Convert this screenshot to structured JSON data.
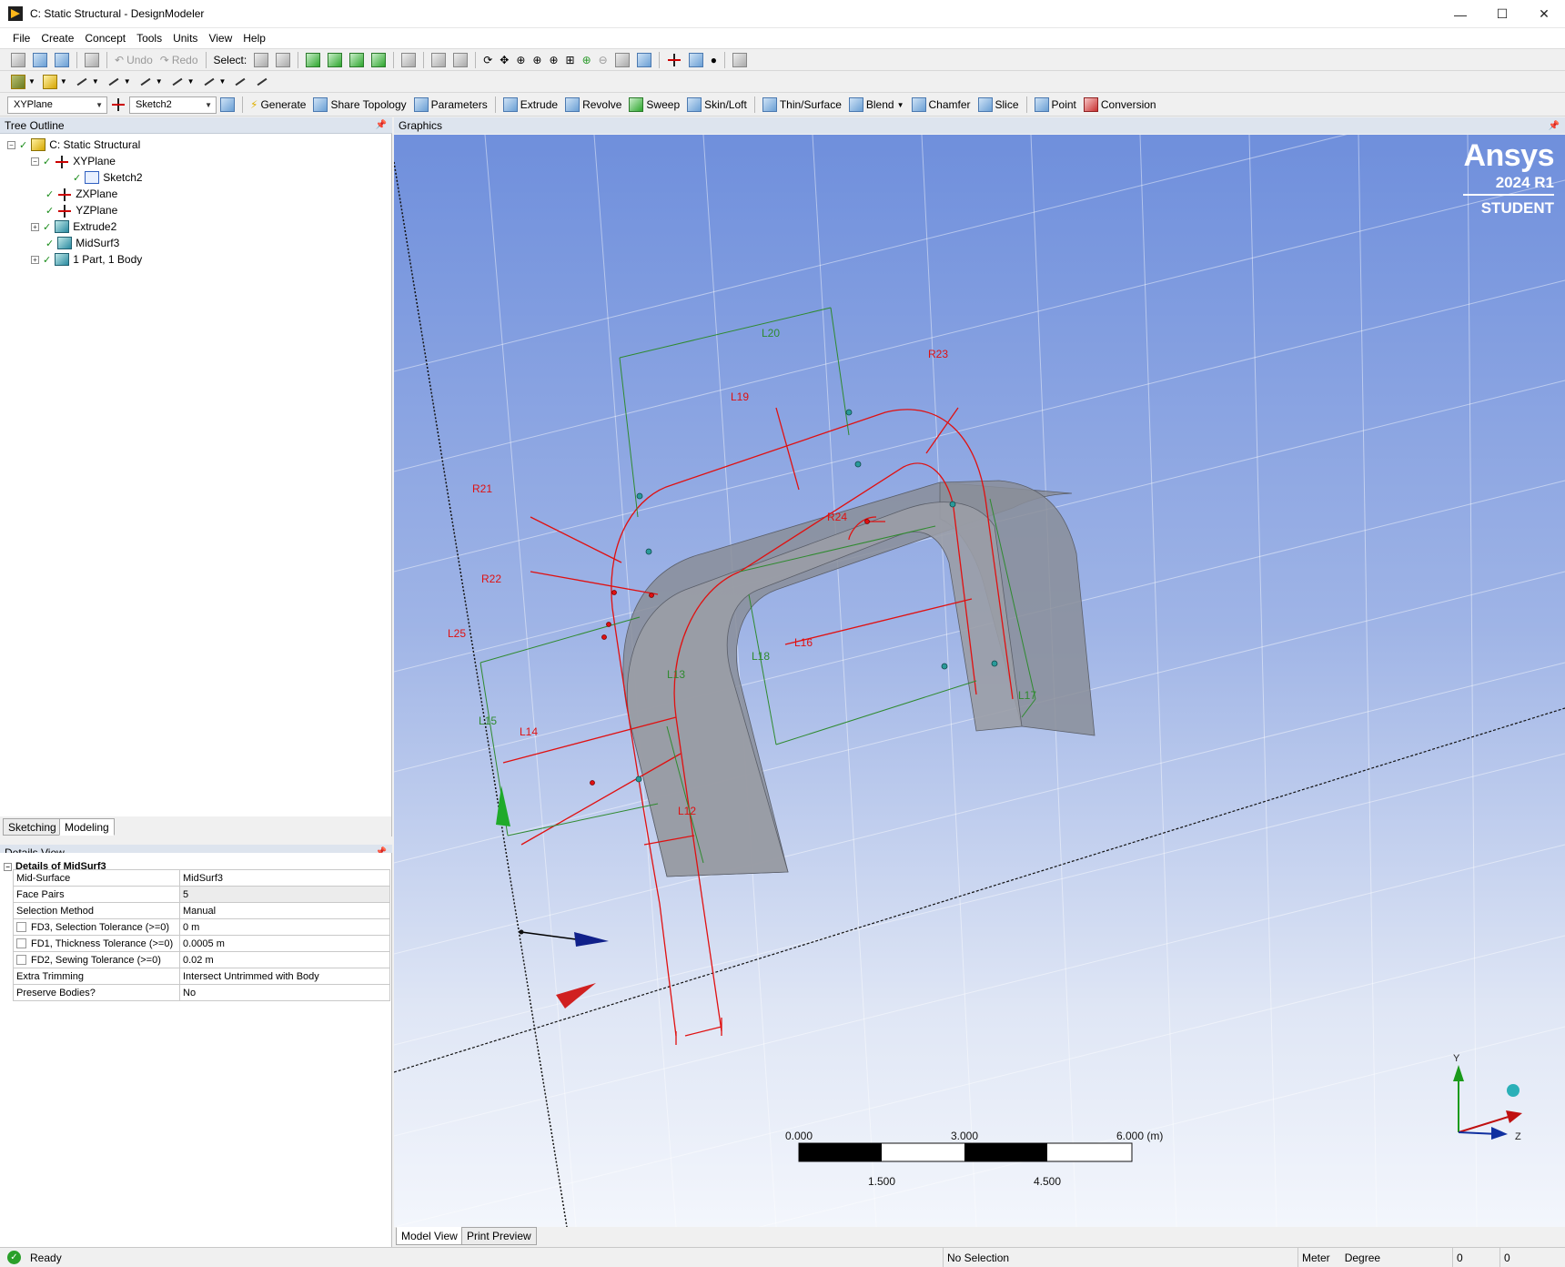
{
  "window": {
    "title": "C: Static Structural - DesignModeler",
    "controls": {
      "minimize": "—",
      "maximize": "☐",
      "close": "✕"
    }
  },
  "menu": [
    "File",
    "Create",
    "Concept",
    "Tools",
    "Units",
    "View",
    "Help"
  ],
  "toolbar1": {
    "undo": "Undo",
    "redo": "Redo",
    "select_label": "Select:"
  },
  "toolbar3": {
    "plane": "XYPlane",
    "sketch": "Sketch2",
    "buttons": [
      "Generate",
      "Share Topology",
      "Parameters",
      "Extrude",
      "Revolve",
      "Sweep",
      "Skin/Loft",
      "Thin/Surface",
      "Blend",
      "Chamfer",
      "Slice",
      "Point",
      "Conversion"
    ]
  },
  "tree": {
    "header": "Tree Outline",
    "items": [
      "C: Static Structural",
      "XYPlane",
      "Sketch2",
      "ZXPlane",
      "YZPlane",
      "Extrude2",
      "MidSurf3",
      "1 Part, 1 Body"
    ]
  },
  "mode_tabs": {
    "sketching": "Sketching",
    "modeling": "Modeling"
  },
  "details": {
    "header": "Details View",
    "group": "Details of MidSurf3",
    "rows": [
      {
        "key": "Mid-Surface",
        "value": "MidSurf3"
      },
      {
        "key": "Face Pairs",
        "value": "5"
      },
      {
        "key": "Selection Method",
        "value": "Manual"
      },
      {
        "key": "FD3, Selection Tolerance (>=0)",
        "value": "0 m"
      },
      {
        "key": "FD1, Thickness Tolerance (>=0)",
        "value": "0.0005 m"
      },
      {
        "key": "FD2, Sewing Tolerance (>=0)",
        "value": "0.02 m"
      },
      {
        "key": "Extra Trimming",
        "value": "Intersect Untrimmed with Body"
      },
      {
        "key": "Preserve Bodies?",
        "value": "No"
      }
    ]
  },
  "graphics": {
    "header": "Graphics",
    "brand": {
      "name": "Ansys",
      "version": "2024 R1",
      "edition": "STUDENT"
    },
    "dim_labels": {
      "L20": "L20",
      "R23": "R23",
      "L19": "L19",
      "R21": "R21",
      "R24": "R24",
      "R22": "R22",
      "L25": "L25",
      "L16": "L16",
      "L18": "L18",
      "L13": "L13",
      "L17": "L17",
      "L15": "L15",
      "L14": "L14",
      "L12": "L12"
    },
    "scale": {
      "t0": "0.000",
      "t1": "3.000",
      "t2": "6.000 (m)",
      "b1": "1.500",
      "b2": "4.500"
    },
    "triad": {
      "y": "Y",
      "z": "Z"
    },
    "colors": {
      "sketch_red": "#e01010",
      "dim_green": "#2f8a2f",
      "body_gray": "#8a8e99"
    }
  },
  "view_tabs": {
    "model": "Model View",
    "print": "Print Preview"
  },
  "status": {
    "ready": "Ready",
    "selection": "No Selection",
    "unit_length": "Meter",
    "unit_angle": "Degree",
    "v1": "0",
    "v2": "0"
  }
}
